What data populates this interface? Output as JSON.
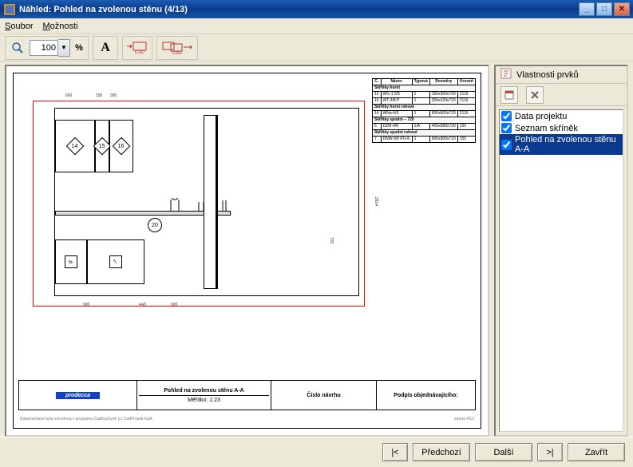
{
  "window": {
    "title": "Náhled: Pohled na zvolenou stěnu (4/13)"
  },
  "menu": {
    "file": "Soubor",
    "options": "Možnosti"
  },
  "toolbar": {
    "zoom_value": "100",
    "percent": "%",
    "letter": "A"
  },
  "sheet": {
    "table_headers": {
      "c1": "Č.",
      "c2": "Název",
      "c3": "Typová",
      "c4": "Rozměry",
      "c5": "Úroveň"
    },
    "sections": [
      {
        "title": "Skříňky horní"
      },
      {
        "c1": "15",
        "c2": "WG-1 5/5",
        "c3": "1",
        "c4": "150x300x720",
        "c5": "2116"
      },
      {
        "c1": "16",
        "c2": "WT-3/8 P",
        "c3": "1",
        "c4": "300x320x720",
        "c5": "2116"
      },
      {
        "title": "Skříňky horní rohové"
      },
      {
        "c1": "14",
        "c2": "WNa-6/6",
        "c3": "1",
        "c4": "600x600x720",
        "c5": "2116"
      },
      {
        "title": "Skříňky spodní – 720"
      },
      {
        "c1": "6",
        "c2": "DZM-4/8",
        "c3": "1/A",
        "c4": "400x580x720",
        "c5": "150"
      },
      {
        "title": "Skříňky spodní rohové"
      },
      {
        "c1": "7",
        "c2": "DNW-9/9 PO-K",
        "c3": "1",
        "c4": "900x900x720",
        "c5": "150"
      }
    ],
    "titleblock": {
      "logo": "prodecca",
      "main": "Pohled na zvolenou stěnu A-A",
      "scale": "Měřítko: 1:23",
      "col3": "Číslo návrhu",
      "col4": "Podpis objednávajícího:"
    },
    "footer_left": "Dokumentace byla vytvořena v programu CadKuchyně (c) CadProjekt K&A",
    "footer_right": "strana 4/13",
    "cab_nums": {
      "a": "14",
      "b": "15",
      "c": "16",
      "d": "6",
      "e": "7",
      "f": "20"
    },
    "dims": {
      "top1": "600",
      "top2": "150",
      "top3": "300",
      "bot1": "900",
      "bot2": "4w0",
      "bot3": "900",
      "right_h": "2814",
      "side_h": "720"
    }
  },
  "sidebar": {
    "title": "Vlastnosti prvků",
    "items": [
      {
        "label": "Data projektu",
        "checked": true,
        "selected": false
      },
      {
        "label": "Seznam skříněk",
        "checked": true,
        "selected": false
      },
      {
        "label": "Pohled na zvolenou stěnu A-A",
        "checked": true,
        "selected": true
      }
    ]
  },
  "buttons": {
    "first": "|<",
    "prev": "Předchozí",
    "next": "Další",
    "last": ">|",
    "close": "Zavřít"
  }
}
